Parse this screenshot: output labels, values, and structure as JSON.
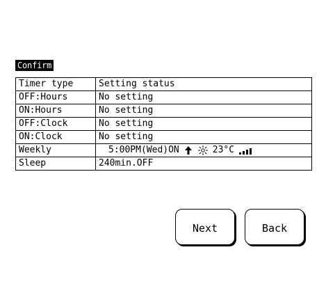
{
  "screen": {
    "title": "Confirm"
  },
  "table": {
    "header": {
      "col1": "Timer type",
      "col2": "Setting status"
    },
    "rows": [
      {
        "type": "OFF:Hours",
        "status": "No setting"
      },
      {
        "type": "ON:Hours",
        "status": "No setting"
      },
      {
        "type": "OFF:Clock",
        "status": "No setting"
      },
      {
        "type": "ON:Clock",
        "status": "No setting"
      },
      {
        "type": "Weekly",
        "status": "5:00PM(Wed)ON",
        "icons": [
          "up-arrow-icon",
          "sun-heat-icon",
          "fan-speed-icon"
        ],
        "temperature": "23°C"
      },
      {
        "type": "Sleep",
        "status": "240min.OFF"
      }
    ]
  },
  "buttons": {
    "next_label": "Next",
    "back_label": "Back"
  }
}
